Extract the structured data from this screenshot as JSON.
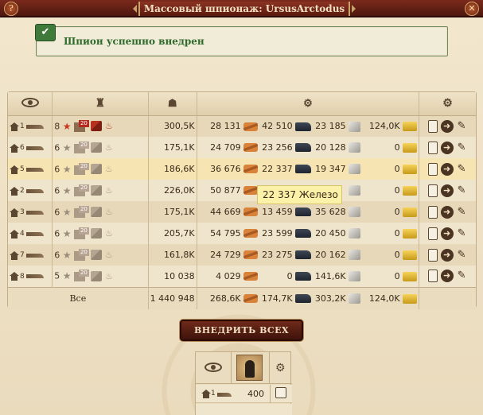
{
  "window": {
    "title": "Массовый шпионаж: UrsusArctodus",
    "help_glyph": "?",
    "close_glyph": "✕"
  },
  "toast": {
    "message": "Шпион успешно внедрен"
  },
  "table": {
    "rows": [
      {
        "village": "1",
        "spies": "8",
        "score": "300,5K",
        "wood": "28 131",
        "iron": "42 510",
        "stone": "23 185",
        "gold": "124,0K",
        "badge": "20",
        "active": true
      },
      {
        "village": "6",
        "spies": "6",
        "score": "175,1K",
        "wood": "24 709",
        "iron": "23 256",
        "stone": "20 128",
        "gold": "0",
        "badge": "20",
        "active": false
      },
      {
        "village": "5",
        "spies": "6",
        "score": "186,6K",
        "wood": "36 676",
        "iron": "22 337",
        "stone": "19 347",
        "gold": "0",
        "badge": "20",
        "active": false
      },
      {
        "village": "2",
        "spies": "6",
        "score": "226,0K",
        "wood": "50 877",
        "iron": "",
        "stone": "",
        "gold": "0",
        "badge": "20",
        "active": false
      },
      {
        "village": "3",
        "spies": "6",
        "score": "175,1K",
        "wood": "44 669",
        "iron": "13 459",
        "stone": "35 628",
        "gold": "0",
        "badge": "20",
        "active": false
      },
      {
        "village": "4",
        "spies": "6",
        "score": "205,7K",
        "wood": "54 795",
        "iron": "23 599",
        "stone": "20 450",
        "gold": "0",
        "badge": "20",
        "active": false
      },
      {
        "village": "7",
        "spies": "6",
        "score": "161,8K",
        "wood": "24 729",
        "iron": "23 275",
        "stone": "20 162",
        "gold": "0",
        "badge": "20",
        "active": false
      },
      {
        "village": "8",
        "spies": "5",
        "score": "10 038",
        "wood": "4 029",
        "iron": "0",
        "stone": "141,6K",
        "gold": "0",
        "badge": "20",
        "active": false
      }
    ],
    "total": {
      "label": "Все",
      "score": "1 440 948",
      "wood": "268,6K",
      "iron": "174,7K",
      "stone": "303,2K",
      "gold": "124,0K"
    }
  },
  "tooltip": {
    "text": "22 337 Железо"
  },
  "buttons": {
    "infiltrate_all": "ВНЕДРИТЬ ВСЕХ"
  },
  "mini_panel": {
    "row_level": "1",
    "row_value": "400"
  }
}
